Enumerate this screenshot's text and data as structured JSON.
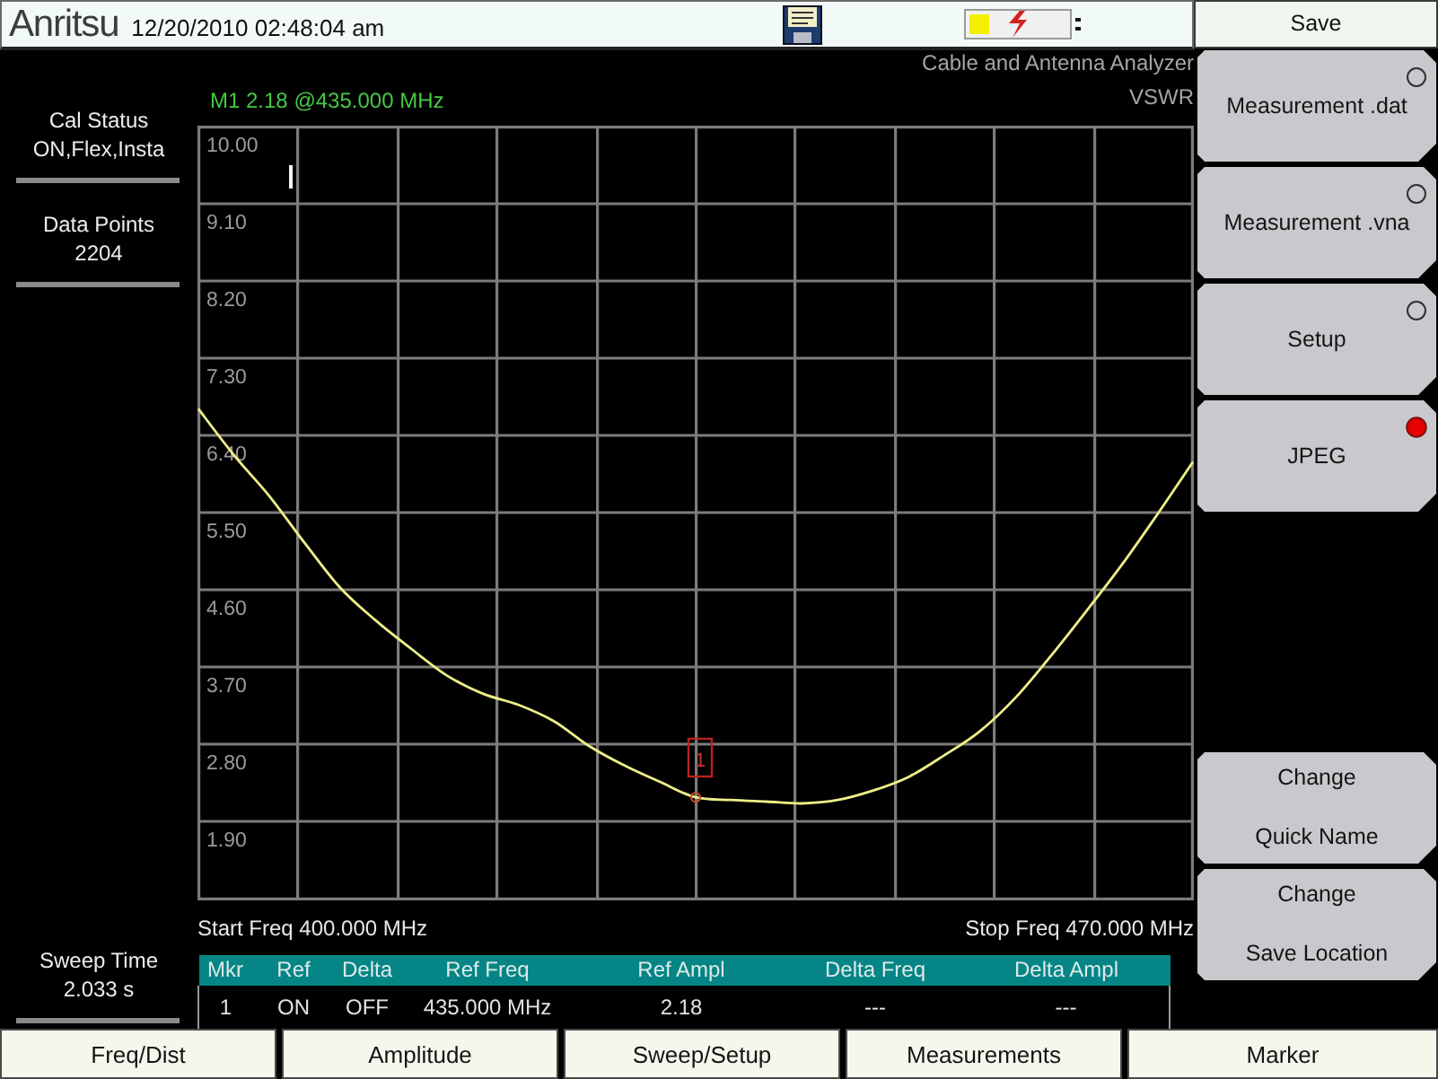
{
  "status_bar": {
    "logo": "Anritsu",
    "datetime": "12/20/2010 02:48:04 am"
  },
  "header": {
    "mode": "Cable and Antenna Analyzer",
    "measurement": "VSWR",
    "marker_readout": "M1 2.18 @435.000 MHz"
  },
  "left_panel": {
    "top": [
      {
        "label": "Cal Status",
        "value": "ON,Flex,Insta"
      },
      {
        "label": "Data Points",
        "value": "2204"
      }
    ],
    "bottom": [
      {
        "label": "Sweep Time",
        "value": "2.033 s"
      }
    ]
  },
  "chart": {
    "start_freq": "Start Freq 400.000 MHz",
    "stop_freq": "Stop Freq 470.000 MHz",
    "chart_data": {
      "type": "line",
      "categories": [
        null,
        null,
        null,
        null,
        null,
        null,
        null,
        null,
        null,
        null,
        null,
        null,
        null,
        null,
        null,
        null,
        null,
        null,
        null,
        null,
        null,
        null,
        null,
        null,
        null,
        null,
        null,
        null,
        null
      ],
      "series": [
        {
          "color": "#eeee88",
          "values": [
            6.71,
            6.17,
            5.69,
            5.14,
            4.62,
            4.24,
            3.91,
            3.6,
            3.39,
            3.26,
            3.07,
            2.78,
            2.55,
            2.36,
            2.18,
            2.15,
            2.13,
            2.11,
            2.15,
            2.26,
            2.42,
            2.67,
            2.95,
            3.34,
            3.83,
            4.35,
            4.89,
            5.48,
            6.09
          ]
        }
      ],
      "ylim": [
        1,
        10
      ],
      "yticks": [
        {
          "value": 10,
          "label": "10.00"
        },
        {
          "value": 9.1,
          "label": "9.10"
        },
        {
          "value": 8.2,
          "label": "8.20"
        },
        {
          "value": 7.3,
          "label": "7.30"
        },
        {
          "value": 6.4,
          "label": "6.40"
        },
        {
          "value": 5.5,
          "label": "5.50"
        },
        {
          "value": 4.6,
          "label": "4.60"
        },
        {
          "value": 3.7,
          "label": "3.70"
        },
        {
          "value": 2.8,
          "label": "2.80"
        },
        {
          "value": 1.9,
          "label": "1.90"
        }
      ],
      "grid": true,
      "annotations": [
        {
          "y": 2.18,
          "text": "1"
        }
      ]
    }
  },
  "marker_table": {
    "columns": [
      "Mkr",
      "Ref",
      "Delta",
      "Ref Freq",
      "Ref Ampl",
      "Delta Freq",
      "Delta Ampl"
    ],
    "rows": [
      [
        "1",
        "ON",
        "OFF",
        "435.000 MHz",
        "2.18",
        "---",
        "---"
      ]
    ]
  },
  "menu": {
    "title": "Save",
    "options": [
      {
        "label": "Measurement .dat",
        "selected": false
      },
      {
        "label": "Measurement .vna",
        "selected": false
      },
      {
        "label": "Setup",
        "selected": false
      },
      {
        "label": "JPEG",
        "selected": true
      }
    ],
    "actions": [
      {
        "lines": [
          "Change",
          "Quick Name"
        ]
      },
      {
        "lines": [
          "Change",
          "Save Location"
        ]
      }
    ]
  },
  "tabs": [
    {
      "label": "Freq/Dist"
    },
    {
      "label": "Amplitude"
    },
    {
      "label": "Sweep/Setup"
    },
    {
      "label": "Measurements"
    },
    {
      "label": "Marker"
    }
  ]
}
